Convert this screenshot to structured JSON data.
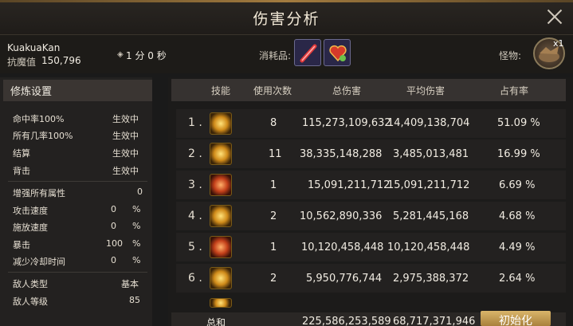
{
  "window": {
    "title": "伤害分析"
  },
  "player": {
    "name": "KuakuaKan",
    "resist_label": "抗魔值",
    "resist_value": "150,796"
  },
  "timer": {
    "icon": "diamond-icon",
    "text": "1 分 0 秒"
  },
  "consumables": {
    "label": "消耗品:",
    "items": [
      "potion-icon",
      "heart-chest-icon"
    ]
  },
  "monster": {
    "label": "怪物:",
    "count": "x1",
    "icon": "monster-portrait"
  },
  "settings": {
    "title": "修炼设置",
    "rows": [
      {
        "label": "命中率100%",
        "value": "生效中"
      },
      {
        "label": "所有几率100%",
        "value": "生效中"
      },
      {
        "label": "结算",
        "value": "生效中"
      },
      {
        "label": "背击",
        "value": "生效中"
      }
    ],
    "stats": [
      {
        "label": "增强所有属性",
        "value": "0",
        "unit": ""
      },
      {
        "label": "攻击速度",
        "value": "0",
        "unit": "%"
      },
      {
        "label": "施放速度",
        "value": "0",
        "unit": "%"
      },
      {
        "label": "暴击",
        "value": "100",
        "unit": "%"
      },
      {
        "label": "减少冷却时间",
        "value": "0",
        "unit": "%"
      }
    ],
    "enemy": [
      {
        "label": "敌人类型",
        "value": "基本"
      },
      {
        "label": "敌人等级",
        "value": "85"
      }
    ]
  },
  "table": {
    "headers": {
      "skill": "技能",
      "uses": "使用次数",
      "total": "总伤害",
      "avg": "平均伤害",
      "share": "占有率"
    },
    "rows": [
      {
        "rank": "1 .",
        "icon": "skill-icon-1",
        "uses": "8",
        "total": "115,273,109,632",
        "avg": "14,409,138,704",
        "share": "51.09 %"
      },
      {
        "rank": "2 .",
        "icon": "skill-icon-2",
        "uses": "11",
        "total": "38,335,148,288",
        "avg": "3,485,013,481",
        "share": "16.99 %"
      },
      {
        "rank": "3 .",
        "icon": "skill-icon-3",
        "uses": "1",
        "total": "15,091,211,712",
        "avg": "15,091,211,712",
        "share": "6.69 %"
      },
      {
        "rank": "4 .",
        "icon": "skill-icon-4",
        "uses": "2",
        "total": "10,562,890,336",
        "avg": "5,281,445,168",
        "share": "4.68 %"
      },
      {
        "rank": "5 .",
        "icon": "skill-icon-5",
        "uses": "1",
        "total": "10,120,458,448",
        "avg": "10,120,458,448",
        "share": "4.49 %"
      },
      {
        "rank": "6 .",
        "icon": "skill-icon-6",
        "uses": "2",
        "total": "5,950,776,744",
        "avg": "2,975,388,372",
        "share": "2.64 %"
      }
    ],
    "total": {
      "label": "总和",
      "total": "225,586,253,589",
      "avg": "68,717,371,946"
    }
  },
  "buttons": {
    "reset": "初始化"
  }
}
